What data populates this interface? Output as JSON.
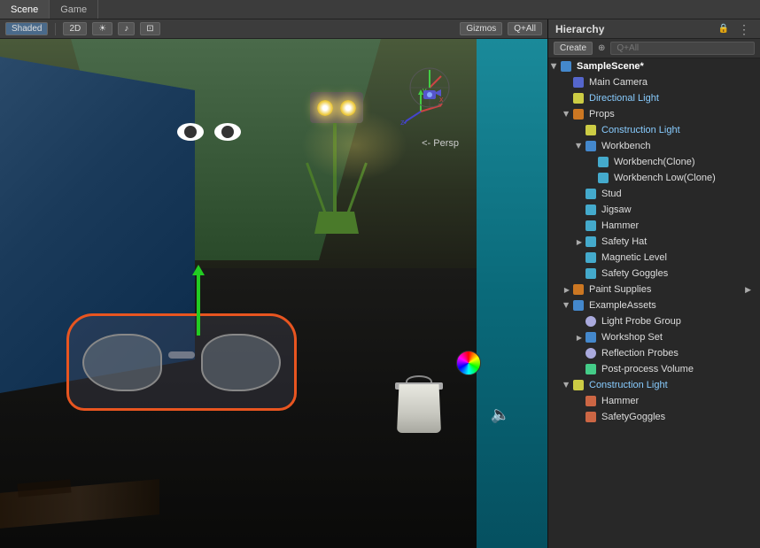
{
  "tabs": {
    "scene": "Scene",
    "game": "Game"
  },
  "viewport": {
    "shading_label": "Shaded",
    "mode_2d": "2D",
    "gizmos_label": "Gizmos",
    "quality_label": "Q+All",
    "persp_label": "<- Persp"
  },
  "hierarchy": {
    "title": "Hierarchy",
    "create_label": "Create",
    "search_placeholder": "Q+All",
    "items": [
      {
        "id": "samplescene",
        "label": "SampleScene*",
        "indent": 0,
        "has_arrow": true,
        "arrow_open": true,
        "icon": "folder-blue"
      },
      {
        "id": "main-camera",
        "label": "Main Camera",
        "indent": 1,
        "has_arrow": false,
        "icon": "camera"
      },
      {
        "id": "directional-light",
        "label": "Directional Light",
        "indent": 1,
        "has_arrow": false,
        "icon": "light"
      },
      {
        "id": "props",
        "label": "Props",
        "indent": 1,
        "has_arrow": true,
        "arrow_open": true,
        "icon": "folder-orange"
      },
      {
        "id": "construction-light-1",
        "label": "Construction Light",
        "indent": 2,
        "has_arrow": false,
        "icon": "light"
      },
      {
        "id": "workbench",
        "label": "Workbench",
        "indent": 2,
        "has_arrow": true,
        "arrow_open": true,
        "icon": "folder-blue"
      },
      {
        "id": "workbench-clone",
        "label": "Workbench(Clone)",
        "indent": 3,
        "has_arrow": false,
        "icon": "mesh"
      },
      {
        "id": "workbench-low-clone",
        "label": "Workbench Low(Clone)",
        "indent": 3,
        "has_arrow": false,
        "icon": "mesh"
      },
      {
        "id": "stud",
        "label": "Stud",
        "indent": 2,
        "has_arrow": false,
        "icon": "mesh"
      },
      {
        "id": "jigsaw",
        "label": "Jigsaw",
        "indent": 2,
        "has_arrow": false,
        "icon": "mesh"
      },
      {
        "id": "hammer",
        "label": "Hammer",
        "indent": 2,
        "has_arrow": false,
        "icon": "mesh"
      },
      {
        "id": "safety-hat",
        "label": "Safety Hat",
        "indent": 2,
        "has_arrow": true,
        "arrow_open": false,
        "icon": "mesh"
      },
      {
        "id": "magnetic-level",
        "label": "Magnetic Level",
        "indent": 2,
        "has_arrow": false,
        "icon": "mesh"
      },
      {
        "id": "safety-goggles",
        "label": "Safety Goggles",
        "indent": 2,
        "has_arrow": false,
        "icon": "mesh"
      },
      {
        "id": "paint-supplies",
        "label": "Paint Supplies",
        "indent": 1,
        "has_arrow": true,
        "arrow_open": false,
        "icon": "folder-orange"
      },
      {
        "id": "example-assets",
        "label": "ExampleAssets",
        "indent": 1,
        "has_arrow": true,
        "arrow_open": true,
        "icon": "folder-blue"
      },
      {
        "id": "light-probe-group",
        "label": "Light Probe Group",
        "indent": 2,
        "has_arrow": false,
        "icon": "probe"
      },
      {
        "id": "workshop-set",
        "label": "Workshop Set",
        "indent": 2,
        "has_arrow": true,
        "arrow_open": false,
        "icon": "folder-blue"
      },
      {
        "id": "reflection-probes",
        "label": "Reflection Probes",
        "indent": 2,
        "has_arrow": false,
        "icon": "probe"
      },
      {
        "id": "post-process-volume",
        "label": "Post-process Volume",
        "indent": 2,
        "has_arrow": false,
        "icon": "postprocess"
      },
      {
        "id": "construction-light-2",
        "label": "Construction Light",
        "indent": 1,
        "has_arrow": true,
        "arrow_open": true,
        "icon": "light"
      },
      {
        "id": "hammer-2",
        "label": "Hammer",
        "indent": 2,
        "has_arrow": false,
        "icon": "mesh-red"
      },
      {
        "id": "safety-goggles-2",
        "label": "SafetyGoggles",
        "indent": 2,
        "has_arrow": false,
        "icon": "mesh-red"
      }
    ]
  }
}
